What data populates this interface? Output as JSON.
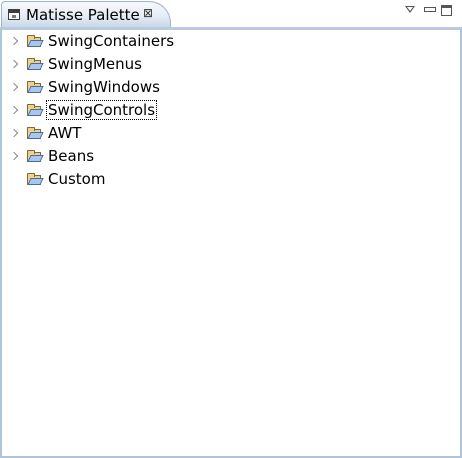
{
  "view": {
    "title": "Matisse Palette",
    "close_glyph": "⊠",
    "icons": {
      "view_icon": "palette-view-icon",
      "close": "close-icon",
      "view_menu": "view-menu-icon",
      "minimize": "minimize-icon",
      "maximize": "maximize-icon"
    }
  },
  "tree": {
    "folder_icon": "open-folder-icon",
    "expander_icon": "chevron-right-icon",
    "items": [
      {
        "label": "SwingContainers",
        "expandable": true,
        "selected": false
      },
      {
        "label": "SwingMenus",
        "expandable": true,
        "selected": false
      },
      {
        "label": "SwingWindows",
        "expandable": true,
        "selected": false
      },
      {
        "label": "SwingControls",
        "expandable": true,
        "selected": true
      },
      {
        "label": "AWT",
        "expandable": true,
        "selected": false
      },
      {
        "label": "Beans",
        "expandable": true,
        "selected": false
      },
      {
        "label": "Custom",
        "expandable": false,
        "selected": false
      }
    ]
  }
}
